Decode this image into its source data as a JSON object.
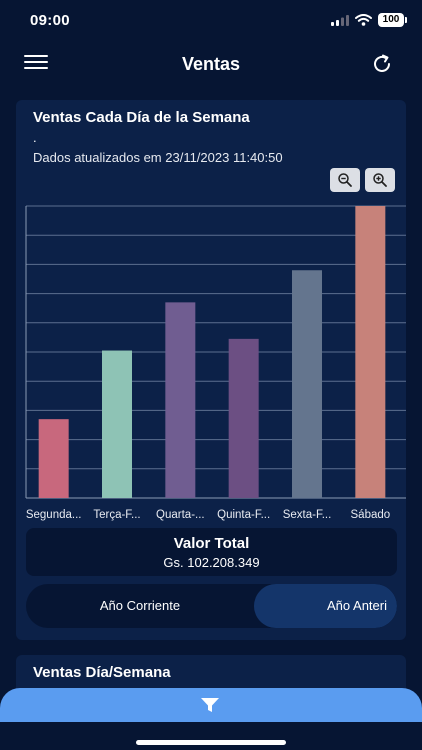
{
  "status_bar": {
    "time": "09:00",
    "battery": "100"
  },
  "header": {
    "title": "Ventas"
  },
  "card": {
    "title": "Ventas Cada Día de la Semana",
    "subtitle": ".",
    "updated": "Dados atualizados em 23/11/2023 11:40:50",
    "total_label": "Valor Total",
    "total_value": "Gs. 102.208.349",
    "toggle": {
      "option_1": "Año Corriente",
      "option_2": "Año Anteri",
      "selected": "Año Anteri"
    }
  },
  "chart_data": {
    "type": "bar",
    "categories": [
      "Segunda...",
      "Terça-F...",
      "Quarta-...",
      "Quinta-F...",
      "Sexta-F...",
      "Sábado"
    ],
    "values": [
      2.7,
      5.05,
      6.7,
      5.45,
      7.8,
      10.0
    ],
    "ylim": [
      0,
      10
    ],
    "grid": true,
    "colors": [
      "#c8687d",
      "#8ec3b5",
      "#705d91",
      "#6c4f83",
      "#64758e",
      "#c7827a"
    ]
  },
  "card2": {
    "title": "Ventas Día/Semana"
  }
}
